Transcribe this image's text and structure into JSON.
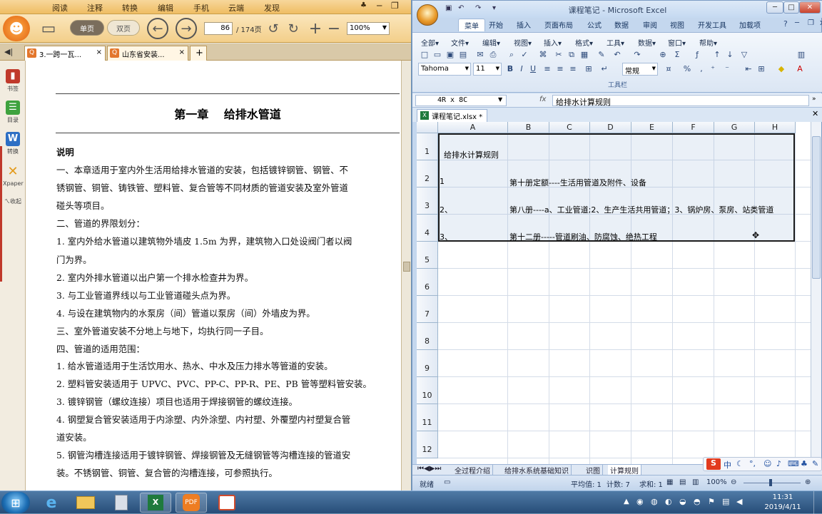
{
  "pdf": {
    "menu": [
      "阅读",
      "注释",
      "转换",
      "编辑",
      "手机",
      "云端",
      "发现"
    ],
    "view_single": "单页",
    "view_double": "双页",
    "page_current": "86",
    "page_total": "/ 174页",
    "zoom": "100%",
    "tabs": [
      "3.一跨一瓦...",
      "山东省安装..."
    ],
    "sidebar": [
      "书签",
      "目录",
      "转换",
      "Xpaper",
      "ㄟ收起"
    ],
    "doc": {
      "title": "第一章　 给排水管道",
      "lines": [
        "说明",
        "一、本章适用于室内外生活用给排水管道的安装，包括镀锌钢管、钢管、不",
        "锈钢管、铜管、铸铁管、塑料管、复合管等不同材质的管道安装及室外管道",
        "碰头等项目。",
        "二、管道的界限划分：",
        "1. 室内外给水管道以建筑物外墙皮 1.5m 为界，建筑物入口处设阀门者以阀",
        "门为界。",
        "2. 室内外排水管道以出户第一个排水检查井为界。",
        "3. 与工业管道界线以与工业管道碰头点为界。",
        "4. 与设在建筑物内的水泵房（间）管道以泵房（间）外墙皮为界。",
        "三、室外管道安装不分地上与地下，均执行同一子目。",
        "四、管道的适用范围：",
        "1. 给水管道适用于生活饮用水、热水、中水及压力排水等管道的安装。",
        "2. 塑料管安装适用于 UPVC、PVC、PP-C、PP-R、PE、PB 管等塑料管安装。",
        "3. 镀锌钢管（螺纹连接）项目也适用于焊接钢管的螺纹连接。",
        "4. 钢塑复合管安装适用于内涂塑、内外涂塑、内衬塑、外覆塑内衬塑复合管",
        "道安装。",
        "5. 钢管沟槽连接适用于镀锌钢管、焊接钢管及无缝钢管等沟槽连接的管道安",
        "装。不锈钢管、铜管、复合管的沟槽连接，可参照执行。"
      ]
    }
  },
  "excel": {
    "window_title": "课程笔记 - Microsoft Excel",
    "ribbon_tabs": [
      "菜单",
      "开始",
      "插入",
      "页面布局",
      "公式",
      "数据",
      "审阅",
      "视图",
      "开发工具",
      "加载项"
    ],
    "menu_items": [
      "全部▾",
      "文件▾",
      "编辑▾",
      "视图▾",
      "插入▾",
      "格式▾",
      "工具▾",
      "数据▾",
      "窗口▾",
      "帮助▾"
    ],
    "font": "Tahoma",
    "font_size": "11",
    "number_format": "常规",
    "toolbar_group": "工具栏",
    "name_box": "4R x 8C",
    "formula": "给排水计算规则",
    "doc_tab": "课程笔记.xlsx *",
    "columns": [
      "A",
      "B",
      "C",
      "D",
      "E",
      "F",
      "G",
      "H"
    ],
    "rows": [
      "1",
      "2",
      "3",
      "4",
      "5",
      "6",
      "7",
      "8",
      "9",
      "10",
      "11",
      "12"
    ],
    "cells": [
      {
        "row": "1",
        "text": "给排水计算规则"
      },
      {
        "row": "2",
        "a": "1",
        "b": "第十册定额----生活用管道及附件、设备"
      },
      {
        "row": "3",
        "a": "2、",
        "b": "第八册----a、工业管道;2、生产生活共用管道；3、锅炉房、泵房、站类管道"
      },
      {
        "row": "4",
        "a": "3、",
        "b": "第十二册-----管道刷油、防腐蚀、绝热工程"
      }
    ],
    "sheet_tabs": [
      "全过程介绍",
      "给排水系统基础知识",
      "识图",
      "计算规则"
    ],
    "status": {
      "ready": "就绪",
      "average": "平均值: 1",
      "count": "计数: 7",
      "sum": "求和: 1",
      "zoom": "100%"
    }
  },
  "taskbar": {
    "time": "11:31",
    "date": "2019/4/11"
  },
  "ime": {
    "label": "S中"
  }
}
